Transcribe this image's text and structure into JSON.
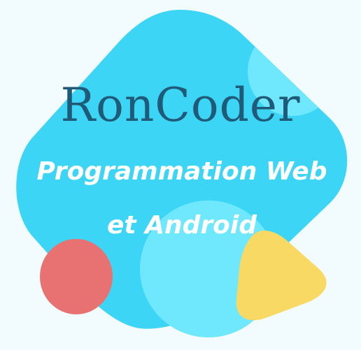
{
  "logo": {
    "title": "RonCoder",
    "tagline_line1": "Programmation Web",
    "tagline_line2": "et Android"
  },
  "colors": {
    "background": "#f2fbfd",
    "badge": "#3dd5f5",
    "highlight": "#6fe7fc",
    "title_text": "#1f5a78",
    "tagline_text": "#ffffff",
    "red_blob": "#e87272",
    "yellow_blob": "#f8d964"
  }
}
